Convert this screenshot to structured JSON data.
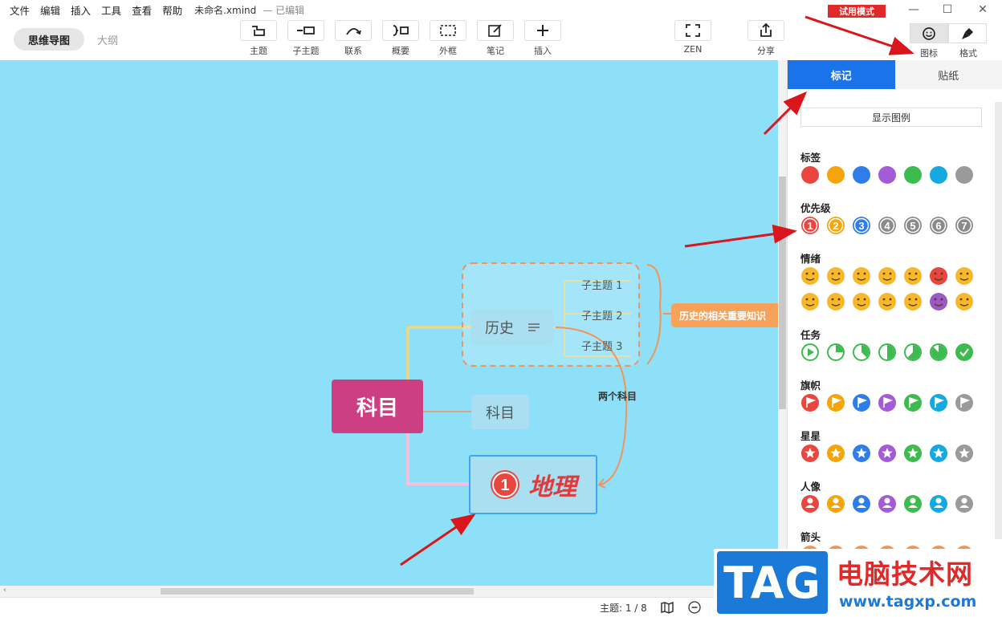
{
  "menu": [
    "文件",
    "编辑",
    "插入",
    "工具",
    "查看",
    "帮助"
  ],
  "file_name": "未命名.xmind",
  "edit_status": "— 已编辑",
  "trial_badge": "试用模式",
  "view_switch": {
    "active": "思维导图",
    "inactive": "大纲"
  },
  "toolbar": {
    "topic": "主题",
    "subtopic": "子主题",
    "relationship": "联系",
    "summary": "概要",
    "boundary": "外框",
    "note": "笔记",
    "insert": "插入",
    "zen": "ZEN",
    "share": "分享"
  },
  "right_tabs": {
    "icon": "图标",
    "format": "格式"
  },
  "panel": {
    "tab_active": "标记",
    "tab_inactive": "贴纸",
    "legend_button": "显示图例",
    "sections": {
      "tags": "标签",
      "priority": "优先级",
      "emotion": "情绪",
      "task": "任务",
      "flag": "旗帜",
      "star": "星星",
      "person": "人像",
      "arrow": "箭头"
    },
    "tag_colors": [
      "#e8463e",
      "#f5a50a",
      "#2f7de8",
      "#a35bd6",
      "#3dbb4f",
      "#14a9e0",
      "#9a9a9a"
    ],
    "priority_numbers": [
      "1",
      "2",
      "3",
      "4",
      "5",
      "6",
      "7"
    ],
    "priority_colors": [
      "#e8463e",
      "#f5a50a",
      "#2f7de8",
      "#8a8a8a",
      "#8a8a8a",
      "#8a8a8a",
      "#8a8a8a"
    ],
    "task_fills": [
      0,
      0.25,
      0.375,
      0.5,
      0.625,
      0.875,
      1
    ]
  },
  "mindmap": {
    "root": "科目",
    "branch_history": "历史",
    "branch_subject": "科目",
    "branch_geo": "地理",
    "geo_priority": "1",
    "subtopics": [
      "子主题 1",
      "子主题 2",
      "子主题 3"
    ],
    "summary_text": "历史的相关重要知识",
    "relationship_label": "两个科目"
  },
  "statusbar": {
    "topics": "主题: 1 / 8"
  },
  "watermark": {
    "tag": "TAG",
    "cn": "电脑技术网",
    "url": "www.tagxp.com"
  },
  "colors": {
    "canvas": "#8edff8",
    "accent": "#1a73e8",
    "root": "#cc3f82",
    "trial": "#e02a2a"
  }
}
